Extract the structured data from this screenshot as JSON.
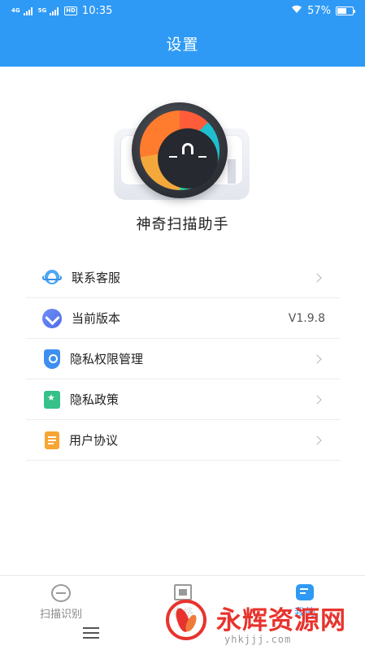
{
  "status_bar": {
    "network_1": "4G",
    "network_2": "5G",
    "hd": "HD",
    "time": "10:35",
    "battery": "57%",
    "battery_level": 0.57
  },
  "header": {
    "title": "设置"
  },
  "app": {
    "name": "神奇扫描助手"
  },
  "settings": {
    "items": [
      {
        "label": "联系客服",
        "icon": "headset-icon"
      },
      {
        "label": "当前版本",
        "value": "V1.9.8",
        "icon": "version-icon"
      },
      {
        "label": "隐私权限管理",
        "icon": "shield-key-icon"
      },
      {
        "label": "隐私政策",
        "icon": "policy-icon"
      },
      {
        "label": "用户协议",
        "icon": "document-icon"
      }
    ]
  },
  "tabbar": {
    "tabs": [
      {
        "label": "扫描识别",
        "icon": "scan-face-icon"
      },
      {
        "label": "表格",
        "icon": "scan-frame-icon"
      },
      {
        "label": "我的",
        "icon": "profile-icon"
      }
    ]
  },
  "watermark": {
    "text": "永辉资源网",
    "url": "yhkjjj.com"
  },
  "colors": {
    "primary": "#2f9af5",
    "watermark_red": "#e8332d"
  }
}
